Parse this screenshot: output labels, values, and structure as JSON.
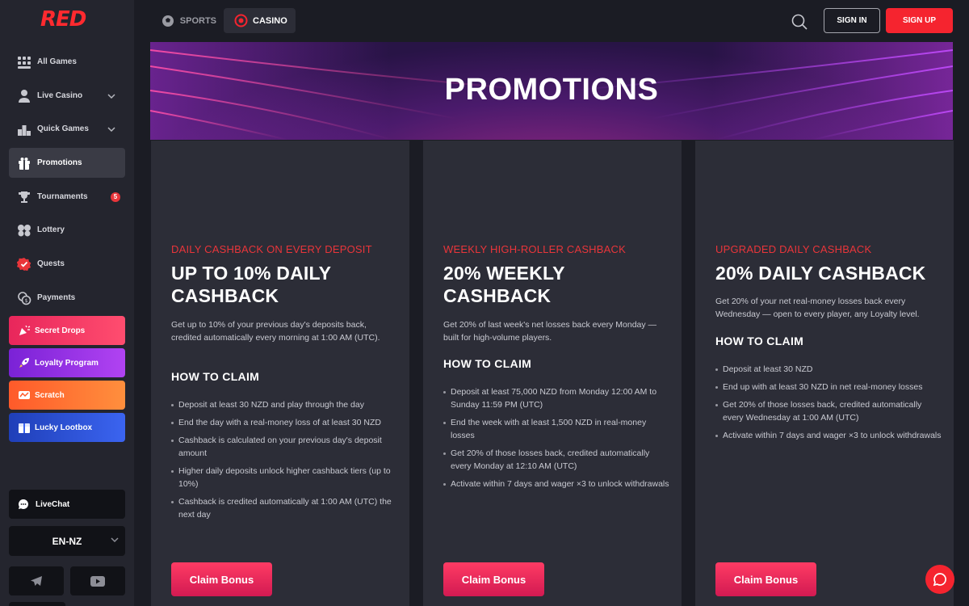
{
  "brand": {
    "logo": "RED",
    "accent": "#f5242f"
  },
  "sidebar": {
    "items": [
      {
        "label": "All Games",
        "icon": "grid-icon"
      },
      {
        "label": "Live Casino",
        "icon": "dealer-icon"
      },
      {
        "label": "Quick Games",
        "icon": "podium-icon"
      },
      {
        "label": "Promotions",
        "icon": "gift-icon",
        "active": true
      },
      {
        "label": "Tournaments",
        "icon": "trophy-icon",
        "badge": "5"
      },
      {
        "label": "Lottery",
        "icon": "balls-icon"
      },
      {
        "label": "Quests",
        "icon": "quest-icon"
      },
      {
        "label": "Payments",
        "icon": "coins-icon"
      }
    ],
    "promos": [
      {
        "label": "Secret Drops",
        "icon": "confetti-icon"
      },
      {
        "label": "Loyalty Program",
        "icon": "rocket-icon"
      },
      {
        "label": "Scratch",
        "icon": "scratch-icon"
      },
      {
        "label": "Lucky Lootbox",
        "icon": "lootbox-icon"
      }
    ],
    "livechat": "LiveChat",
    "language": "EN-NZ"
  },
  "topbar": {
    "sports": "SPORTS",
    "casino": "CASINO",
    "signin": "SIGN IN",
    "signup": "SIGN UP"
  },
  "hero": {
    "title": "PROMOTIONS"
  },
  "cards": [
    {
      "kicker": "DAILY CASHBACK ON EVERY DEPOSIT",
      "title": "UP TO 10% DAILY CASHBACK",
      "desc": "Get up to 10% of your previous day's deposits back, credited automatically every morning at 1:00 AM (UTC).",
      "how": "HOW TO CLAIM",
      "steps": [
        "Deposit at least 30 NZD and play through the day",
        "End the day with a real-money loss of at least 30 NZD",
        "Cashback is calculated on your previous day's deposit amount",
        "Higher daily deposits unlock higher cashback tiers (up to 10%)",
        "Cashback is credited automatically at 1:00 AM (UTC) the next day"
      ],
      "cta": "Claim Bonus"
    },
    {
      "kicker": "WEEKLY HIGH-ROLLER CASHBACK",
      "title": "20% WEEKLY CASHBACK",
      "desc": "Get 20% of last week's net losses back every Monday — built for high-volume players.",
      "how": "HOW TO CLAIM",
      "steps": [
        "Deposit at least 75,000 NZD from Monday 12:00 AM to Sunday 11:59 PM (UTC)",
        "End the week with at least 1,500 NZD in real-money losses",
        "Get 20% of those losses back, credited automatically every Monday at 12:10 AM (UTC)",
        "Activate within 7 days and wager ×3 to unlock withdrawals"
      ],
      "cta": "Claim Bonus"
    },
    {
      "kicker": "UPGRADED DAILY CASHBACK",
      "title": "20% DAILY CASHBACK",
      "desc": "Get 20% of your net real-money losses back every Wednesday — open to every player, any Loyalty level.",
      "how": "HOW TO CLAIM",
      "steps": [
        "Deposit at least 30 NZD",
        "End up with at least 30 NZD in net real-money losses",
        "Get 20% of those losses back, credited automatically every Wednesday at 1:00 AM (UTC)",
        "Activate within 7 days and wager ×3 to unlock withdrawals"
      ],
      "cta": "Claim Bonus"
    }
  ]
}
